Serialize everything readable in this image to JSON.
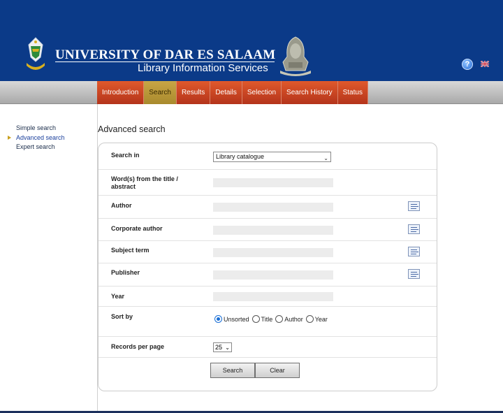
{
  "header": {
    "university_name": "UNIVERSITY OF DAR ES SALAAM",
    "subtitle": "Library Information Services",
    "help_icon": "question-icon",
    "language_icon": "uk-flag-icon",
    "help_glyph": "?"
  },
  "nav": {
    "tabs": [
      {
        "label": "Introduction"
      },
      {
        "label": "Search"
      },
      {
        "label": "Results"
      },
      {
        "label": "Details"
      },
      {
        "label": "Selection"
      },
      {
        "label": "Search History"
      },
      {
        "label": "Status"
      }
    ],
    "active_tab": "Search"
  },
  "sidebar": {
    "items": [
      {
        "label": "Simple search"
      },
      {
        "label": "Advanced search"
      },
      {
        "label": "Expert search"
      }
    ],
    "active_item": "Advanced search"
  },
  "main": {
    "title": "Advanced search",
    "form": {
      "search_in_label": "Search in",
      "search_in_value": "Library catalogue",
      "words_label": "Word(s) from the title / abstract",
      "author_label": "Author",
      "corporate_author_label": "Corporate author",
      "subject_term_label": "Subject term",
      "publisher_label": "Publisher",
      "year_label": "Year",
      "sort_by_label": "Sort by",
      "sort_options": [
        {
          "label": "Unsorted",
          "checked": true
        },
        {
          "label": "Title",
          "checked": false
        },
        {
          "label": "Author",
          "checked": false
        },
        {
          "label": "Year",
          "checked": false
        }
      ],
      "records_per_page_label": "Records per page",
      "records_per_page_value": "25",
      "search_button": "Search",
      "clear_button": "Clear"
    }
  },
  "colors": {
    "header_bg": "#0b3a88",
    "tab_bg": "#c8401f",
    "tab_active_bg": "#b8973a"
  }
}
